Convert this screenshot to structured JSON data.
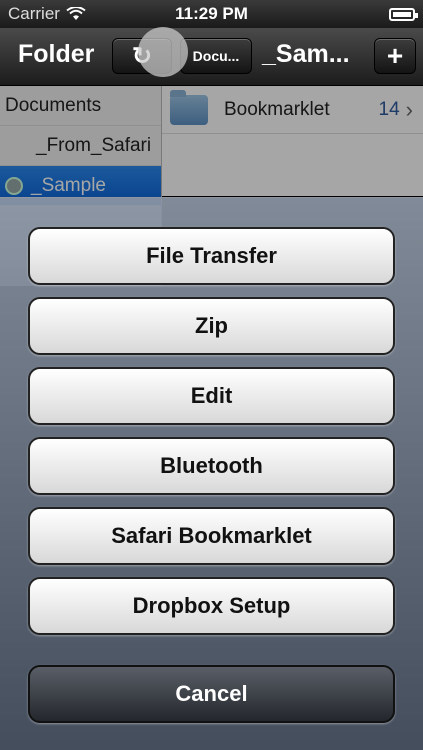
{
  "status": {
    "carrier": "Carrier",
    "time": "11:29 PM"
  },
  "toolbar": {
    "title": "Folder",
    "refresh_glyph": "↻",
    "docs_label": "Docu...",
    "current_label": "_Sam...",
    "add_glyph": "+"
  },
  "tree": {
    "items": [
      {
        "label": "Documents"
      },
      {
        "label": "_From_Safari"
      },
      {
        "label": "_Sample"
      }
    ]
  },
  "files": {
    "items": [
      {
        "name": "Bookmarklet",
        "count": "14"
      }
    ]
  },
  "sheet": {
    "buttons": [
      {
        "label": "File Transfer"
      },
      {
        "label": "Zip"
      },
      {
        "label": "Edit"
      },
      {
        "label": "Bluetooth"
      },
      {
        "label": "Safari Bookmarklet"
      },
      {
        "label": "Dropbox Setup"
      }
    ],
    "cancel_label": "Cancel"
  },
  "colors": {
    "accent": "#0b62d8",
    "count": "#2e5b9e"
  },
  "icons": [
    "wifi-icon",
    "battery-icon",
    "refresh-icon",
    "add-icon",
    "folder-icon",
    "chevron-right-icon"
  ]
}
